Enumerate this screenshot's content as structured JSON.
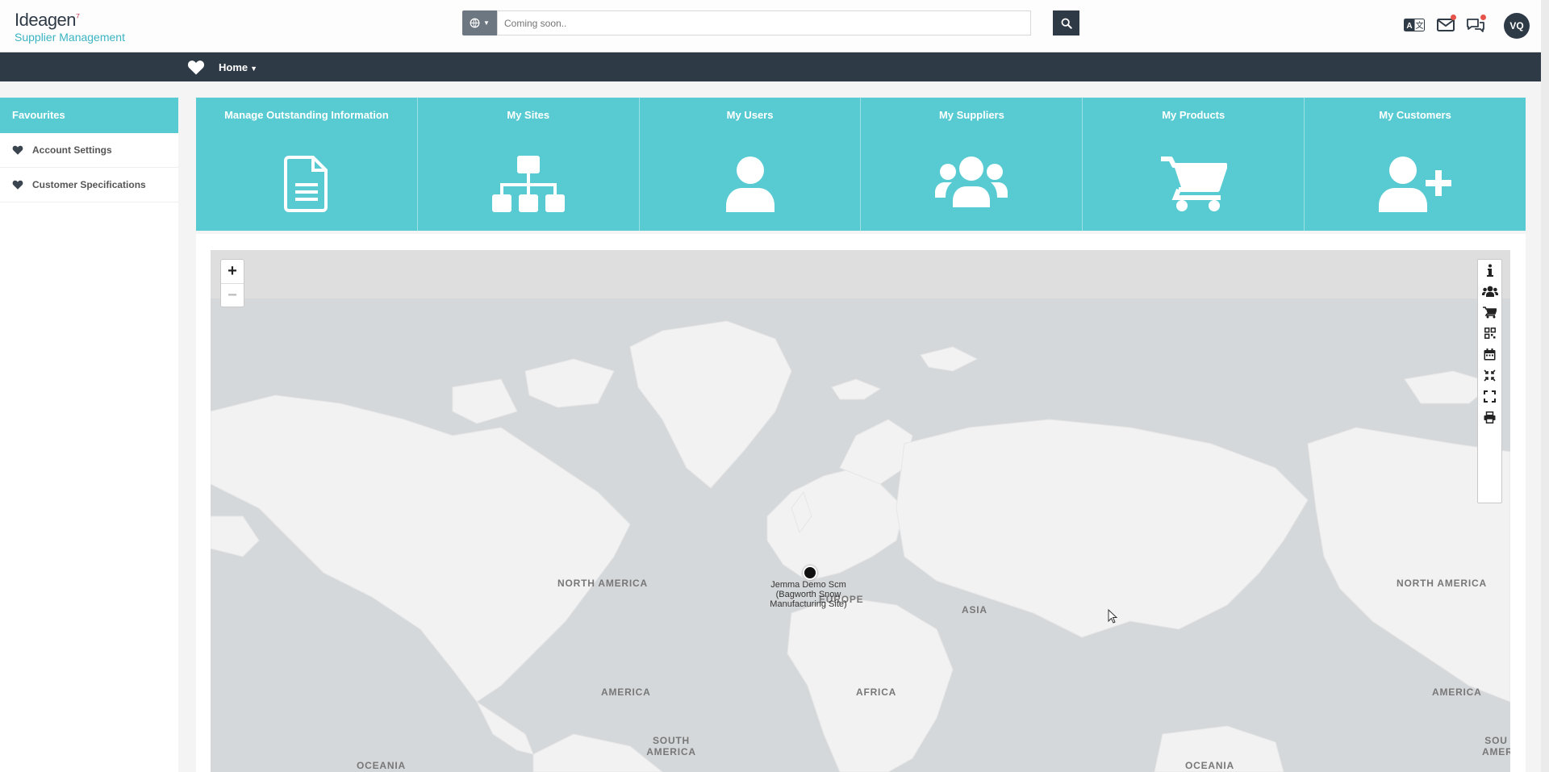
{
  "header": {
    "logo_brand": "Ideagen",
    "logo_sub": "Supplier Management",
    "search_placeholder": "Coming soon..",
    "user_initials": "VQ"
  },
  "nav": {
    "home_label": "Home"
  },
  "sidebar": {
    "title": "Favourites",
    "items": [
      {
        "label": "Account Settings"
      },
      {
        "label": "Customer Specifications"
      }
    ]
  },
  "tiles": [
    {
      "label": "Manage Outstanding Information",
      "icon": "document-icon"
    },
    {
      "label": "My Sites",
      "icon": "sitemap-icon"
    },
    {
      "label": "My Users",
      "icon": "user-icon"
    },
    {
      "label": "My Suppliers",
      "icon": "users-icon"
    },
    {
      "label": "My Products",
      "icon": "cart-icon"
    },
    {
      "label": "My Customers",
      "icon": "user-plus-icon"
    }
  ],
  "map": {
    "zoom_in": "+",
    "zoom_out": "−",
    "marker_label": "Jemma Demo Scm (Bagworth Snow Manufacturing Site)",
    "regions": {
      "north_america_left": "NORTH AMERICA",
      "north_america_right": "NORTH AMERICA",
      "europe": "EUROPE",
      "asia": "ASIA",
      "africa": "AFRICA",
      "america_left": "AMERICA",
      "america_right": "AMERICA",
      "south_america": "SOUTH AMERICA",
      "south_america_right": "SOU AMER",
      "oceania_left": "OCEANIA",
      "oceania_right": "OCEANIA"
    },
    "tools": [
      "info-icon",
      "users-icon",
      "cart-icon",
      "qrcode-icon",
      "calendar-icon",
      "compress-icon",
      "fullscreen-icon",
      "print-icon"
    ]
  },
  "colors": {
    "accent": "#58cbd2",
    "navbar": "#2f3a47",
    "map_water": "#d5d8da",
    "map_land": "#f2f2f2"
  }
}
